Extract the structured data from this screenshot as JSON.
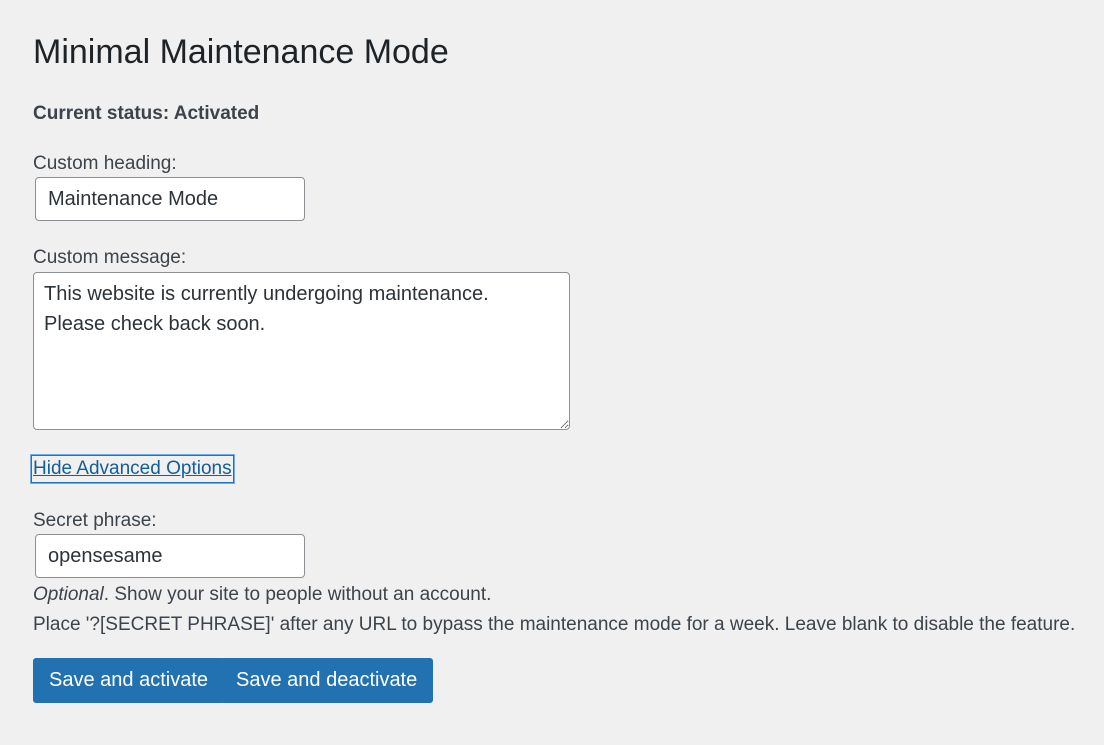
{
  "page": {
    "title": "Minimal Maintenance Mode",
    "status": "Current status: Activated"
  },
  "form": {
    "heading_label": "Custom heading:",
    "heading_value": "Maintenance Mode",
    "message_label": "Custom message:",
    "message_value": "This website is currently undergoing maintenance.\nPlease check back soon.",
    "advanced_toggle": "Hide Advanced Options",
    "secret_label": "Secret phrase:",
    "secret_value": "opensesame",
    "secret_desc_optional": "Optional",
    "secret_desc_line1_rest": ". Show your site to people without an account.",
    "secret_desc_line2": "Place '?[SECRET PHRASE]' after any URL to bypass the maintenance mode for a week. Leave blank to disable the feature."
  },
  "actions": {
    "save_activate": "Save and activate",
    "save_deactivate": "Save and deactivate"
  },
  "colors": {
    "background": "#f0f0f1",
    "primary_button": "#2271b1",
    "link": "#135e96",
    "focus_ring": "#72aee6"
  }
}
